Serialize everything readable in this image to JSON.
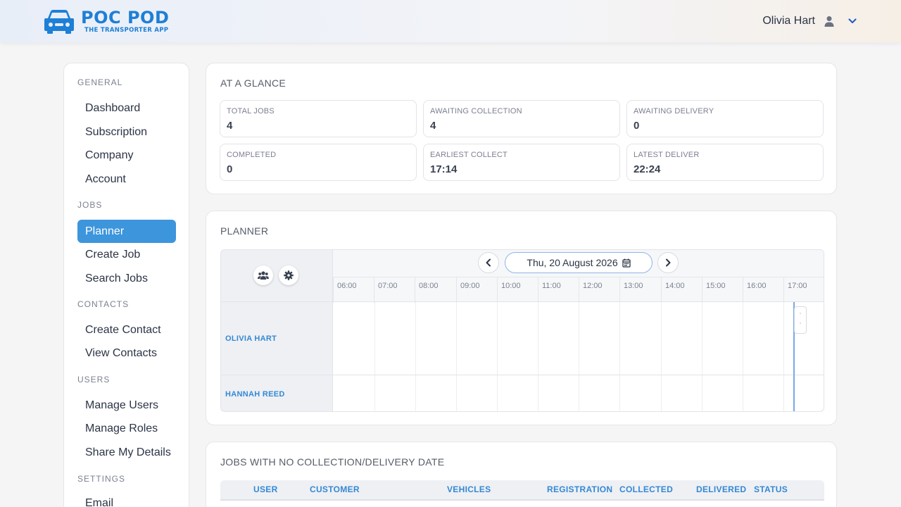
{
  "app": {
    "title": "POC POD",
    "subtitle": "THE TRANSPORTER APP",
    "brand_color": "#1d7fd6"
  },
  "user": {
    "name": "Olivia Hart"
  },
  "sidebar": {
    "sections": [
      {
        "label": "GENERAL",
        "items": [
          "Dashboard",
          "Subscription",
          "Company",
          "Account"
        ]
      },
      {
        "label": "JOBS",
        "items": [
          "Planner",
          "Create Job",
          "Search Jobs"
        ]
      },
      {
        "label": "CONTACTS",
        "items": [
          "Create Contact",
          "View Contacts"
        ]
      },
      {
        "label": "USERS",
        "items": [
          "Manage Users",
          "Manage Roles",
          "Share My Details"
        ]
      },
      {
        "label": "SETTINGS",
        "items": [
          "Email"
        ]
      }
    ],
    "active_item": "Planner",
    "accent_color": "#3d95dc"
  },
  "glance": {
    "title": "AT A GLANCE",
    "stats": [
      {
        "label": "TOTAL JOBS",
        "value": "4"
      },
      {
        "label": "AWAITING COLLECTION",
        "value": "4"
      },
      {
        "label": "AWAITING DELIVERY",
        "value": "0"
      },
      {
        "label": "COMPLETED",
        "value": "0"
      },
      {
        "label": "EARLIEST COLLECT",
        "value": "17:14"
      },
      {
        "label": "LATEST DELIVER",
        "value": "22:24"
      }
    ]
  },
  "planner": {
    "title": "PLANNER",
    "date": "Thu, 20 August 2026",
    "hours": [
      "06:00",
      "07:00",
      "08:00",
      "09:00",
      "10:00",
      "11:00",
      "12:00",
      "13:00",
      "14:00",
      "15:00",
      "16:00",
      "17:00"
    ],
    "rows": [
      "OLIVIA HART",
      "HANNAH REED"
    ]
  },
  "jobs_table": {
    "title": "JOBS WITH NO COLLECTION/DELIVERY DATE",
    "columns": [
      "USER",
      "CUSTOMER",
      "VEHICLES",
      "REGISTRATION",
      "COLLECTED",
      "DELIVERED",
      "STATUS"
    ]
  }
}
